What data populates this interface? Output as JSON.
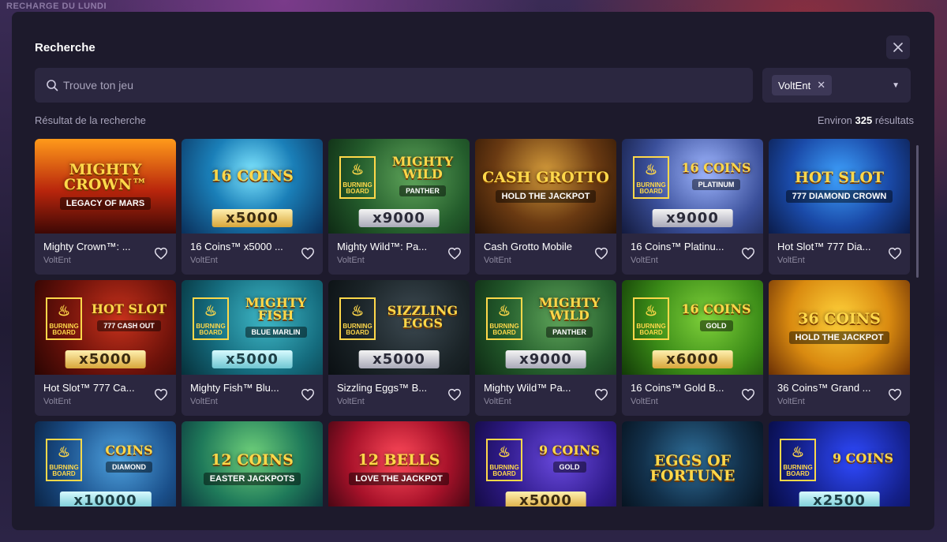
{
  "background": {
    "banner": "RECHARGE DU LUNDI"
  },
  "modal": {
    "title": "Recherche",
    "close_icon": "close-icon"
  },
  "search": {
    "placeholder": "Trouve ton jeu",
    "value": ""
  },
  "filter": {
    "selected": "VoltEnt",
    "remove_icon": "x-icon",
    "dropdown_icon": "caret-down-icon"
  },
  "results": {
    "label": "Résultat de la recherche",
    "prefix": "Environ",
    "count": "325",
    "suffix": "résultats"
  },
  "colors": {
    "modal_bg": "#1d1a2c",
    "field_bg": "#2b2740",
    "muted_text": "#a8a4bb",
    "gold": "#ffd84a"
  },
  "games": [
    {
      "name": "Mighty Crown™: ...",
      "provider": "VoltEnt",
      "art_title": "MIGHTY CROWN™",
      "art_sub": "LEGACY OF MARS",
      "art_mult": "",
      "burning_board": false,
      "bg": "linear-gradient(180deg,#ff9a1a 0%,#b8250c 55%,#3d0805 100%)"
    },
    {
      "name": "16 Coins™ x5000 ...",
      "provider": "VoltEnt",
      "art_title": "16 COINS",
      "art_sub": "",
      "art_mult": "x5000",
      "burning_board": false,
      "bg": "radial-gradient(circle at 50% 35%,#7fe6ff 0%,#1a7fb8 45%,#0a2f5a 100%)"
    },
    {
      "name": "Mighty Wild™: Pa...",
      "provider": "VoltEnt",
      "art_title": "MIGHTY WILD",
      "art_sub": "PANTHER",
      "art_mult": "x9000",
      "mult_style": "silver",
      "burning_board": true,
      "bg": "radial-gradient(circle at 60% 40%,#5fa55a 0%,#245d2c 55%,#0e2a14 100%)"
    },
    {
      "name": "Cash Grotto Mobile",
      "provider": "VoltEnt",
      "art_title": "CASH GROTTO",
      "art_sub": "HOLD THE JACKPOT",
      "art_mult": "",
      "burning_board": false,
      "bg": "radial-gradient(circle at 50% 35%,#d39a3a 0%,#6a3a12 55%,#2a1405 100%)"
    },
    {
      "name": "16 Coins™ Platinu...",
      "provider": "VoltEnt",
      "art_title": "16 COINS",
      "art_sub": "PLATINUM",
      "art_mult": "x9000",
      "mult_style": "silver",
      "burning_board": true,
      "bg": "radial-gradient(circle at 60% 35%,#9fb6ff 0%,#3a4f9a 55%,#131a3d 100%)"
    },
    {
      "name": "Hot Slot™ 777 Dia...",
      "provider": "VoltEnt",
      "art_title": "HOT SLOT",
      "art_sub": "777 DIAMOND CROWN",
      "art_mult": "",
      "burning_board": false,
      "bg": "radial-gradient(circle at 50% 40%,#3fa3ff 0%,#1a4aa8 55%,#0b1c4a 100%)"
    },
    {
      "name": "Hot Slot™ 777 Ca...",
      "provider": "VoltEnt",
      "art_title": "HOT SLOT",
      "art_sub": "777 CASH OUT",
      "art_mult": "x5000",
      "burning_board": true,
      "bg": "radial-gradient(circle at 60% 40%,#c8321c 0%,#6d120a 55%,#2a0503 100%)"
    },
    {
      "name": "Mighty Fish™ Blu...",
      "provider": "VoltEnt",
      "art_title": "MIGHTY FISH",
      "art_sub": "BLUE MARLIN",
      "art_mult": "x5000",
      "mult_style": "teal",
      "burning_board": true,
      "bg": "radial-gradient(circle at 60% 40%,#3fb9c8 0%,#156c7e 55%,#06303a 100%)"
    },
    {
      "name": "Sizzling Eggs™ B...",
      "provider": "VoltEnt",
      "art_title": "SIZZLING EGGS",
      "art_sub": "",
      "art_mult": "x5000",
      "mult_style": "silver",
      "burning_board": true,
      "bg": "radial-gradient(circle at 60% 40%,#3d4a52 0%,#1b2428 55%,#0a0f12 100%)"
    },
    {
      "name": "Mighty Wild™ Pa...",
      "provider": "VoltEnt",
      "art_title": "MIGHTY WILD",
      "art_sub": "PANTHER",
      "art_mult": "x9000",
      "mult_style": "silver",
      "burning_board": true,
      "bg": "radial-gradient(circle at 60% 40%,#5fa55a 0%,#245d2c 55%,#0e2a14 100%)"
    },
    {
      "name": "16 Coins™ Gold B...",
      "provider": "VoltEnt",
      "art_title": "16 COINS",
      "art_sub": "GOLD",
      "art_mult": "x6000",
      "burning_board": true,
      "bg": "radial-gradient(circle at 60% 40%,#7fd13a 0%,#3a8a17 55%,#123a07 100%)"
    },
    {
      "name": "36 Coins™ Grand ...",
      "provider": "VoltEnt",
      "art_title": "36 COINS",
      "art_sub": "HOLD THE JACKPOT",
      "art_mult": "",
      "burning_board": false,
      "bg": "radial-gradient(circle at 50% 40%,#ffd23a 0%,#d98a10 55%,#6a2f05 100%)"
    },
    {
      "name": "",
      "provider": "",
      "art_title": "COINS",
      "art_sub": "DIAMOND",
      "art_mult": "x10000",
      "mult_style": "teal",
      "burning_board": true,
      "bg": "radial-gradient(circle at 60% 40%,#4fa3e0 0%,#1a4f8a 55%,#0a1f3d 100%)"
    },
    {
      "name": "",
      "provider": "",
      "art_title": "12 COINS",
      "art_sub": "EASTER JACKPOTS",
      "art_mult": "",
      "burning_board": false,
      "bg": "radial-gradient(circle at 50% 35%,#6fd07a 0%,#1f7a5a 55%,#0a2f3a 100%)"
    },
    {
      "name": "",
      "provider": "",
      "art_title": "12 BELLS",
      "art_sub": "LOVE THE JACKPOT",
      "art_mult": "",
      "burning_board": false,
      "bg": "radial-gradient(circle at 50% 40%,#ff4a5a 0%,#a8122a 55%,#3a0510 100%)"
    },
    {
      "name": "",
      "provider": "",
      "art_title": "9 COINS",
      "art_sub": "GOLD",
      "art_mult": "x5000",
      "burning_board": true,
      "bg": "radial-gradient(circle at 60% 40%,#6a4adf 0%,#2f1a8a 55%,#120a3d 100%)"
    },
    {
      "name": "",
      "provider": "",
      "art_title": "EGGS OF FORTUNE",
      "art_sub": "",
      "art_mult": "",
      "burning_board": false,
      "bg": "radial-gradient(circle at 50% 40%,#2f6f9a 0%,#12304a 55%,#050f1a 100%)"
    },
    {
      "name": "",
      "provider": "",
      "art_title": "9 COINS",
      "art_sub": "",
      "art_mult": "x2500",
      "mult_style": "teal",
      "burning_board": true,
      "bg": "radial-gradient(circle at 60% 40%,#2f4aff 0%,#14208a 55%,#060a3d 100%)"
    }
  ],
  "burning_board_label": "BURNING BOARD",
  "favorite_icon": "heart-outline-icon"
}
